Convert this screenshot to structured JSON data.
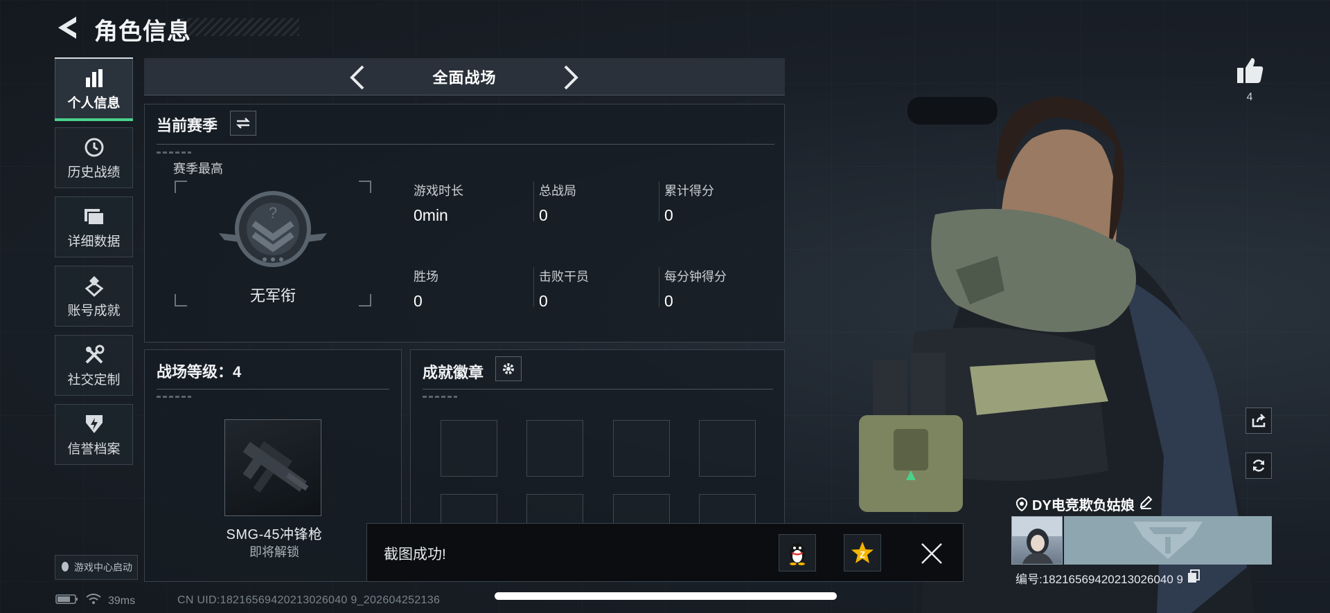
{
  "header": {
    "title": "角色信息"
  },
  "sidebar": {
    "items": [
      {
        "label": "个人信息",
        "icon": "bar-chart-icon"
      },
      {
        "label": "历史战绩",
        "icon": "history-icon"
      },
      {
        "label": "详细数据",
        "icon": "folder-icon"
      },
      {
        "label": "账号成就",
        "icon": "medal-icon"
      },
      {
        "label": "社交定制",
        "icon": "tools-icon"
      },
      {
        "label": "信誉档案",
        "icon": "shield-icon"
      }
    ],
    "launcher": "游戏中心启动"
  },
  "mode": {
    "title": "全面战场"
  },
  "season": {
    "title": "当前赛季",
    "best_label": "赛季最高",
    "rank_name": "无军衔",
    "stats": [
      {
        "label": "游戏时长",
        "value": "0min"
      },
      {
        "label": "总战局",
        "value": "0"
      },
      {
        "label": "累计得分",
        "value": "0"
      },
      {
        "label": "胜场",
        "value": "0"
      },
      {
        "label": "击败干员",
        "value": "0"
      },
      {
        "label": "每分钟得分",
        "value": "0"
      }
    ]
  },
  "battlefield": {
    "title": "战场等级：4",
    "weapon_name": "SMG-45冲锋枪",
    "weapon_status": "即将解锁"
  },
  "badges": {
    "title": "成就徽章"
  },
  "toast": {
    "text": "截图成功!"
  },
  "status": {
    "ping": "39ms",
    "uid": "CN UID:18216569420213026040 9_202604252136"
  },
  "profile": {
    "likes": "4",
    "player_name": "DY电竞欺负姑娘",
    "player_id": "编号:18216569420213026040 9"
  },
  "colors": {
    "accent_green": "#4ad28a",
    "panel_border": "#3a444e",
    "background": "#1a2028"
  }
}
